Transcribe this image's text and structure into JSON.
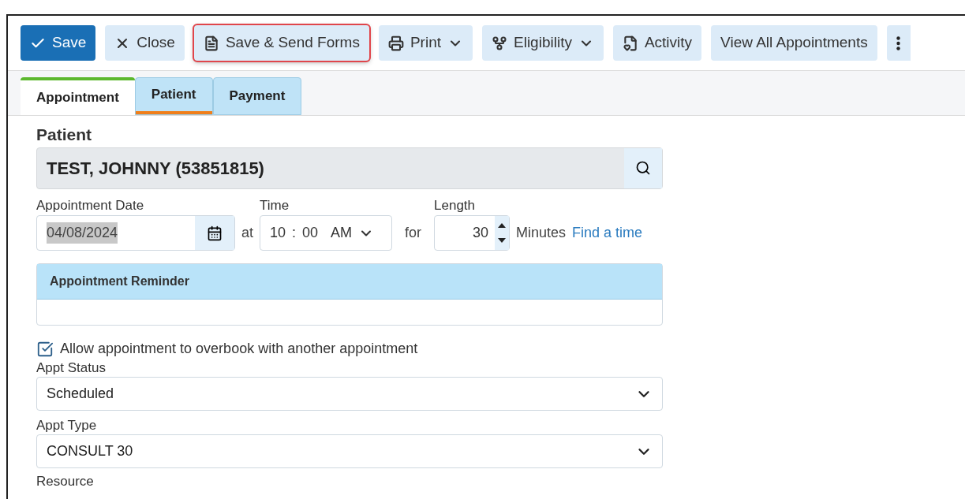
{
  "toolbar": [
    {
      "label": "Save",
      "kind": "primary",
      "dropdown": false,
      "highlighted": false
    },
    {
      "label": "Close",
      "kind": "secondary",
      "dropdown": false,
      "highlighted": false
    },
    {
      "label": "Save & Send Forms",
      "kind": "secondary",
      "dropdown": false,
      "highlighted": true
    },
    {
      "label": "Print",
      "kind": "secondary",
      "dropdown": true,
      "highlighted": false
    },
    {
      "label": "Eligibility",
      "kind": "secondary",
      "dropdown": true,
      "highlighted": false
    },
    {
      "label": "Activity",
      "kind": "secondary",
      "dropdown": false,
      "highlighted": false
    },
    {
      "label": "View All Appointments",
      "kind": "secondary",
      "dropdown": false,
      "highlighted": false
    }
  ],
  "tabs": [
    {
      "label": "Appointment",
      "selected": true,
      "color": "#5cb82e"
    },
    {
      "label": "Patient",
      "selected": false,
      "color": "#f07f1b"
    },
    {
      "label": "Payment",
      "selected": false
    }
  ],
  "patient": {
    "label": "Patient",
    "value": "TEST, JOHNNY (53851815)"
  },
  "date": {
    "label": "Appointment Date",
    "value": "04/08/2024"
  },
  "at_label": "at",
  "time": {
    "label": "Time",
    "hour": "10",
    "separator": ":",
    "minute": "00",
    "ampm": "AM"
  },
  "for_label": "for",
  "length": {
    "label": "Length",
    "value": "30",
    "unit": "Minutes"
  },
  "find_link": "Find a time",
  "reminder": {
    "title": "Appointment Reminder"
  },
  "overbook": {
    "label": "Allow appointment to overbook with another appointment",
    "checked": true
  },
  "selects": [
    {
      "label": "Appt Status",
      "value": "Scheduled"
    },
    {
      "label": "Appt Type",
      "value": "CONSULT 30"
    }
  ],
  "resource_label": "Resource"
}
